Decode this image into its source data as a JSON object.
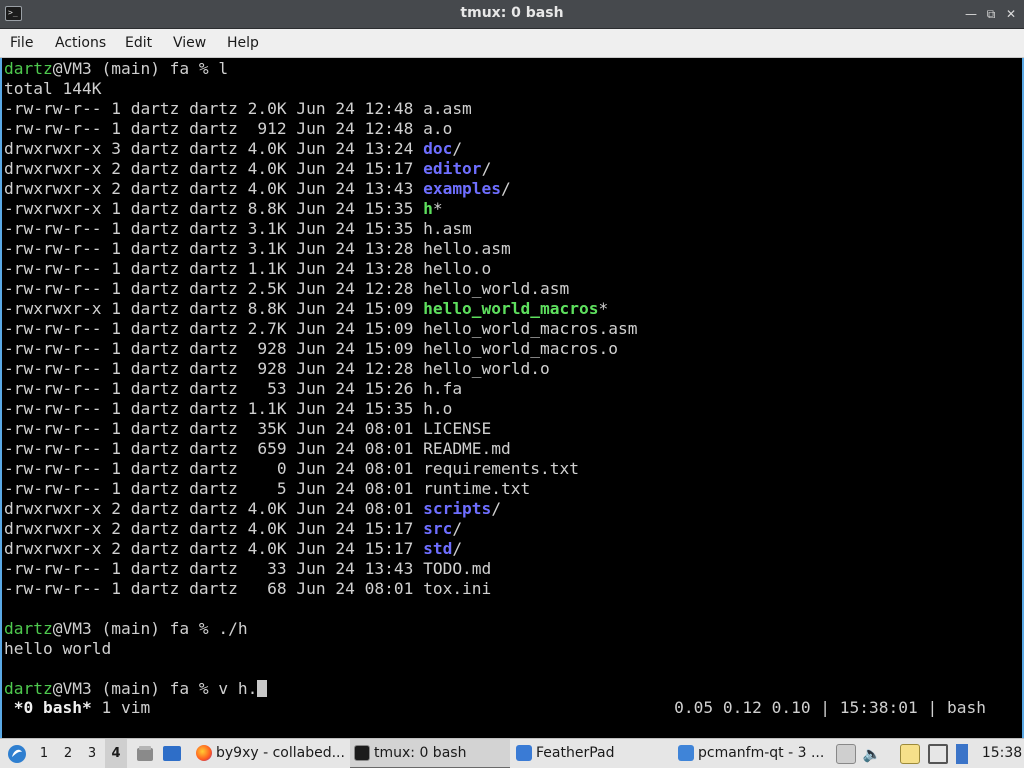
{
  "window": {
    "title": "tmux: 0 bash"
  },
  "menu": [
    "File",
    "Actions",
    "Edit",
    "View",
    "Help"
  ],
  "terminal": {
    "prompt": {
      "user": "dartz",
      "rest": "@VM3 (main) fa % "
    },
    "command1": "l",
    "total": "total 144K",
    "listing": [
      {
        "meta": "-rw-rw-r-- 1 dartz dartz 2.0K Jun 24 12:48 ",
        "name": "a.asm",
        "suffix": "",
        "kind": "file"
      },
      {
        "meta": "-rw-rw-r-- 1 dartz dartz  912 Jun 24 12:48 ",
        "name": "a.o",
        "suffix": "",
        "kind": "file"
      },
      {
        "meta": "drwxrwxr-x 3 dartz dartz 4.0K Jun 24 13:24 ",
        "name": "doc",
        "suffix": "/",
        "kind": "dir"
      },
      {
        "meta": "drwxrwxr-x 2 dartz dartz 4.0K Jun 24 15:17 ",
        "name": "editor",
        "suffix": "/",
        "kind": "dir"
      },
      {
        "meta": "drwxrwxr-x 2 dartz dartz 4.0K Jun 24 13:43 ",
        "name": "examples",
        "suffix": "/",
        "kind": "dir"
      },
      {
        "meta": "-rwxrwxr-x 1 dartz dartz 8.8K Jun 24 15:35 ",
        "name": "h",
        "suffix": "*",
        "kind": "exe"
      },
      {
        "meta": "-rw-rw-r-- 1 dartz dartz 3.1K Jun 24 15:35 ",
        "name": "h.asm",
        "suffix": "",
        "kind": "file"
      },
      {
        "meta": "-rw-rw-r-- 1 dartz dartz 3.1K Jun 24 13:28 ",
        "name": "hello.asm",
        "suffix": "",
        "kind": "file"
      },
      {
        "meta": "-rw-rw-r-- 1 dartz dartz 1.1K Jun 24 13:28 ",
        "name": "hello.o",
        "suffix": "",
        "kind": "file"
      },
      {
        "meta": "-rw-rw-r-- 1 dartz dartz 2.5K Jun 24 12:28 ",
        "name": "hello_world.asm",
        "suffix": "",
        "kind": "file"
      },
      {
        "meta": "-rwxrwxr-x 1 dartz dartz 8.8K Jun 24 15:09 ",
        "name": "hello_world_macros",
        "suffix": "*",
        "kind": "exe"
      },
      {
        "meta": "-rw-rw-r-- 1 dartz dartz 2.7K Jun 24 15:09 ",
        "name": "hello_world_macros.asm",
        "suffix": "",
        "kind": "file"
      },
      {
        "meta": "-rw-rw-r-- 1 dartz dartz  928 Jun 24 15:09 ",
        "name": "hello_world_macros.o",
        "suffix": "",
        "kind": "file"
      },
      {
        "meta": "-rw-rw-r-- 1 dartz dartz  928 Jun 24 12:28 ",
        "name": "hello_world.o",
        "suffix": "",
        "kind": "file"
      },
      {
        "meta": "-rw-rw-r-- 1 dartz dartz   53 Jun 24 15:26 ",
        "name": "h.fa",
        "suffix": "",
        "kind": "file"
      },
      {
        "meta": "-rw-rw-r-- 1 dartz dartz 1.1K Jun 24 15:35 ",
        "name": "h.o",
        "suffix": "",
        "kind": "file"
      },
      {
        "meta": "-rw-rw-r-- 1 dartz dartz  35K Jun 24 08:01 ",
        "name": "LICENSE",
        "suffix": "",
        "kind": "file"
      },
      {
        "meta": "-rw-rw-r-- 1 dartz dartz  659 Jun 24 08:01 ",
        "name": "README.md",
        "suffix": "",
        "kind": "file"
      },
      {
        "meta": "-rw-rw-r-- 1 dartz dartz    0 Jun 24 08:01 ",
        "name": "requirements.txt",
        "suffix": "",
        "kind": "file"
      },
      {
        "meta": "-rw-rw-r-- 1 dartz dartz    5 Jun 24 08:01 ",
        "name": "runtime.txt",
        "suffix": "",
        "kind": "file"
      },
      {
        "meta": "drwxrwxr-x 2 dartz dartz 4.0K Jun 24 08:01 ",
        "name": "scripts",
        "suffix": "/",
        "kind": "dir"
      },
      {
        "meta": "drwxrwxr-x 2 dartz dartz 4.0K Jun 24 15:17 ",
        "name": "src",
        "suffix": "/",
        "kind": "dir"
      },
      {
        "meta": "drwxrwxr-x 2 dartz dartz 4.0K Jun 24 15:17 ",
        "name": "std",
        "suffix": "/",
        "kind": "dir"
      },
      {
        "meta": "-rw-rw-r-- 1 dartz dartz   33 Jun 24 13:43 ",
        "name": "TODO.md",
        "suffix": "",
        "kind": "file"
      },
      {
        "meta": "-rw-rw-r-- 1 dartz dartz   68 Jun 24 08:01 ",
        "name": "tox.ini",
        "suffix": "",
        "kind": "file"
      }
    ],
    "command2": "./h",
    "output2": "hello world",
    "command3": "v h."
  },
  "tmux_status": {
    "active_window": "*0 bash*",
    "other_window": "1 vim",
    "right": "0.05 0.12 0.10 | 15:38:01 | bash"
  },
  "taskbar": {
    "workspaces": [
      "1",
      "2",
      "3",
      "4"
    ],
    "active_workspace": "4",
    "tasks": [
      {
        "label": "by9xy - collabed...",
        "icon": "firefox-icon",
        "active": false
      },
      {
        "label": "tmux: 0 bash",
        "icon": "terminal-icon",
        "active": true
      },
      {
        "label": "FeatherPad",
        "icon": "featherpad-icon",
        "active": false
      },
      {
        "label": "pcmanfm-qt - 3 ...",
        "icon": "folder-icon",
        "active": false
      }
    ],
    "clock": "15:38"
  }
}
